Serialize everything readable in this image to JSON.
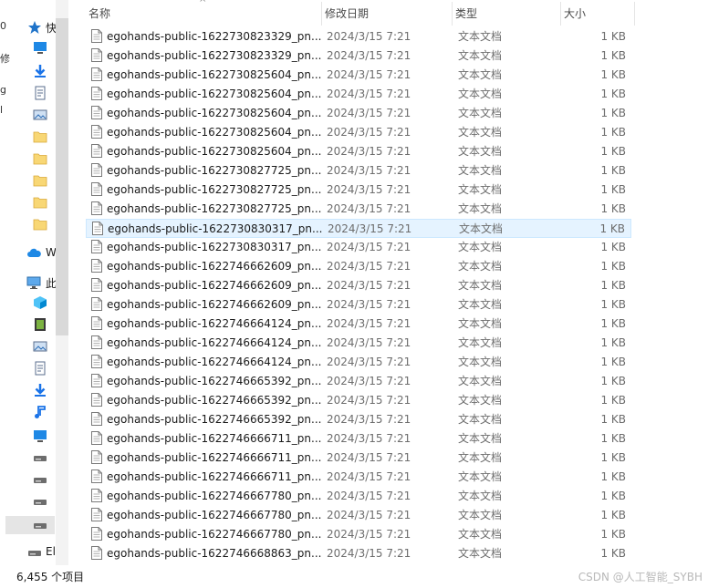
{
  "header": {
    "columns": [
      {
        "key": "name",
        "label": "名称"
      },
      {
        "key": "date",
        "label": "修改日期"
      },
      {
        "key": "type",
        "label": "类型"
      },
      {
        "key": "size",
        "label": "大小"
      }
    ],
    "sort_indicator": "^"
  },
  "nav": {
    "items": [
      {
        "label": "快",
        "icon": "quick-access-star-icon"
      },
      {
        "label": "",
        "icon": "desktop-icon"
      },
      {
        "label": "",
        "icon": "downloads-icon"
      },
      {
        "label": "",
        "icon": "documents-icon"
      },
      {
        "label": "",
        "icon": "pictures-icon"
      },
      {
        "label": "",
        "icon": "folder-icon"
      },
      {
        "label": "",
        "icon": "folder-icon"
      },
      {
        "label": "",
        "icon": "folder-icon"
      },
      {
        "label": "",
        "icon": "folder-icon"
      },
      {
        "label": "",
        "icon": "folder-icon"
      },
      {
        "label": "W",
        "icon": "onedrive-cloud-icon"
      },
      {
        "label": "此",
        "icon": "this-pc-icon"
      },
      {
        "label": "",
        "icon": "3d-objects-icon"
      },
      {
        "label": "",
        "icon": "videos-icon"
      },
      {
        "label": "",
        "icon": "pictures-icon"
      },
      {
        "label": "",
        "icon": "documents-icon"
      },
      {
        "label": "",
        "icon": "downloads-icon"
      },
      {
        "label": "",
        "icon": "music-icon"
      },
      {
        "label": "",
        "icon": "desktop-icon"
      },
      {
        "label": "",
        "icon": "drive-icon"
      },
      {
        "label": "",
        "icon": "drive-icon"
      },
      {
        "label": "",
        "icon": "drive-icon"
      },
      {
        "label": "",
        "icon": "drive-icon"
      },
      {
        "label": "El",
        "icon": "drive-icon"
      }
    ],
    "edge_labels": [
      "0",
      "修",
      "g",
      "l"
    ]
  },
  "files": [
    {
      "name": "egohands-public-1622730823329_pn...",
      "date": "2024/3/15 7:21",
      "type": "文本文档",
      "size": "1 KB"
    },
    {
      "name": "egohands-public-1622730823329_pn...",
      "date": "2024/3/15 7:21",
      "type": "文本文档",
      "size": "1 KB"
    },
    {
      "name": "egohands-public-1622730825604_pn...",
      "date": "2024/3/15 7:21",
      "type": "文本文档",
      "size": "1 KB"
    },
    {
      "name": "egohands-public-1622730825604_pn...",
      "date": "2024/3/15 7:21",
      "type": "文本文档",
      "size": "1 KB"
    },
    {
      "name": "egohands-public-1622730825604_pn...",
      "date": "2024/3/15 7:21",
      "type": "文本文档",
      "size": "1 KB"
    },
    {
      "name": "egohands-public-1622730825604_pn...",
      "date": "2024/3/15 7:21",
      "type": "文本文档",
      "size": "1 KB"
    },
    {
      "name": "egohands-public-1622730825604_pn...",
      "date": "2024/3/15 7:21",
      "type": "文本文档",
      "size": "1 KB"
    },
    {
      "name": "egohands-public-1622730827725_pn...",
      "date": "2024/3/15 7:21",
      "type": "文本文档",
      "size": "1 KB"
    },
    {
      "name": "egohands-public-1622730827725_pn...",
      "date": "2024/3/15 7:21",
      "type": "文本文档",
      "size": "1 KB"
    },
    {
      "name": "egohands-public-1622730827725_pn...",
      "date": "2024/3/15 7:21",
      "type": "文本文档",
      "size": "1 KB"
    },
    {
      "name": "egohands-public-1622730830317_pn...",
      "date": "2024/3/15 7:21",
      "type": "文本文档",
      "size": "1 KB",
      "hover": true
    },
    {
      "name": "egohands-public-1622730830317_pn...",
      "date": "2024/3/15 7:21",
      "type": "文本文档",
      "size": "1 KB"
    },
    {
      "name": "egohands-public-1622746662609_pn...",
      "date": "2024/3/15 7:21",
      "type": "文本文档",
      "size": "1 KB"
    },
    {
      "name": "egohands-public-1622746662609_pn...",
      "date": "2024/3/15 7:21",
      "type": "文本文档",
      "size": "1 KB"
    },
    {
      "name": "egohands-public-1622746662609_pn...",
      "date": "2024/3/15 7:21",
      "type": "文本文档",
      "size": "1 KB"
    },
    {
      "name": "egohands-public-1622746664124_pn...",
      "date": "2024/3/15 7:21",
      "type": "文本文档",
      "size": "1 KB"
    },
    {
      "name": "egohands-public-1622746664124_pn...",
      "date": "2024/3/15 7:21",
      "type": "文本文档",
      "size": "1 KB"
    },
    {
      "name": "egohands-public-1622746664124_pn...",
      "date": "2024/3/15 7:21",
      "type": "文本文档",
      "size": "1 KB"
    },
    {
      "name": "egohands-public-1622746665392_pn...",
      "date": "2024/3/15 7:21",
      "type": "文本文档",
      "size": "1 KB"
    },
    {
      "name": "egohands-public-1622746665392_pn...",
      "date": "2024/3/15 7:21",
      "type": "文本文档",
      "size": "1 KB"
    },
    {
      "name": "egohands-public-1622746665392_pn...",
      "date": "2024/3/15 7:21",
      "type": "文本文档",
      "size": "1 KB"
    },
    {
      "name": "egohands-public-1622746666711_pn...",
      "date": "2024/3/15 7:21",
      "type": "文本文档",
      "size": "1 KB"
    },
    {
      "name": "egohands-public-1622746666711_pn...",
      "date": "2024/3/15 7:21",
      "type": "文本文档",
      "size": "1 KB"
    },
    {
      "name": "egohands-public-1622746666711_pn...",
      "date": "2024/3/15 7:21",
      "type": "文本文档",
      "size": "1 KB"
    },
    {
      "name": "egohands-public-1622746667780_pn...",
      "date": "2024/3/15 7:21",
      "type": "文本文档",
      "size": "1 KB"
    },
    {
      "name": "egohands-public-1622746667780_pn...",
      "date": "2024/3/15 7:21",
      "type": "文本文档",
      "size": "1 KB"
    },
    {
      "name": "egohands-public-1622746667780_pn...",
      "date": "2024/3/15 7:21",
      "type": "文本文档",
      "size": "1 KB"
    },
    {
      "name": "egohands-public-1622746668863_pn...",
      "date": "2024/3/15 7:21",
      "type": "文本文档",
      "size": "1 KB"
    }
  ],
  "status": {
    "item_count": "6,455 个项目"
  },
  "watermark": "CSDN @人工智能_SYBH"
}
